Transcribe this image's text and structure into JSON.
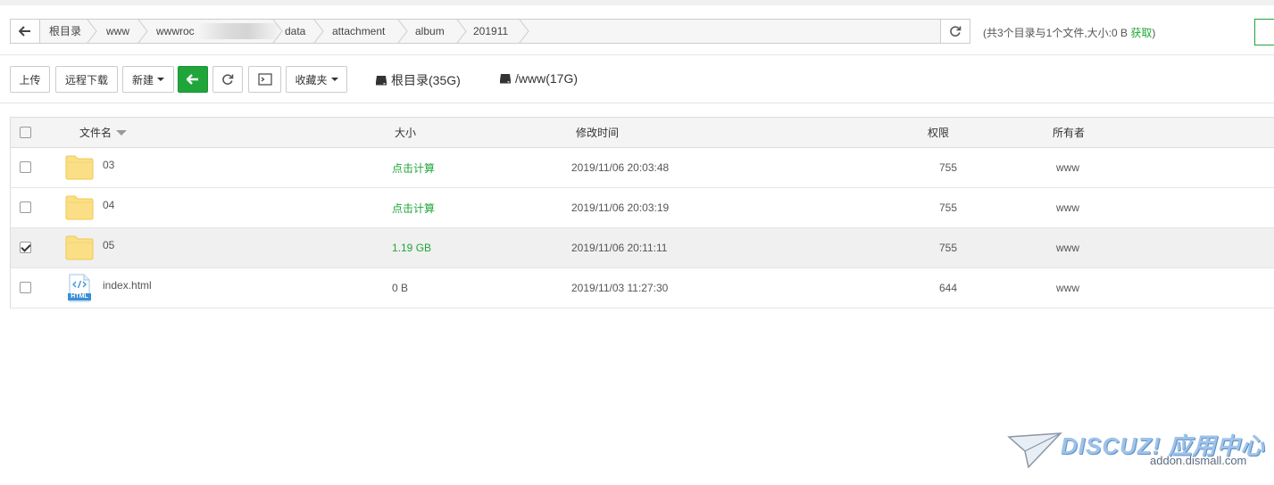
{
  "path": {
    "crumbs": [
      "根目录",
      "www",
      "wwwroc",
      "data",
      "attachment",
      "album",
      "201911"
    ]
  },
  "stats": {
    "summary": "(共3个目录与1个文件,大小:0 B ",
    "get_link": "获取",
    "close_paren": ")"
  },
  "toolbar": {
    "upload": "上传",
    "remote_download": "远程下载",
    "new": "新建",
    "favorites": "收藏夹",
    "disks": [
      {
        "label": "根目录(35G)"
      },
      {
        "label": "/www(17G)"
      }
    ]
  },
  "table": {
    "headers": {
      "name": "文件名",
      "size": "大小",
      "mtime": "修改时间",
      "perm": "权限",
      "owner": "所有者"
    },
    "rows": [
      {
        "name": "03",
        "type": "folder",
        "size": "点击计算",
        "size_is_link": true,
        "mtime": "2019/11/06 20:03:48",
        "perm": "755",
        "owner": "www",
        "checked": false
      },
      {
        "name": "04",
        "type": "folder",
        "size": "点击计算",
        "size_is_link": true,
        "mtime": "2019/11/06 20:03:19",
        "perm": "755",
        "owner": "www",
        "checked": false
      },
      {
        "name": "05",
        "type": "folder",
        "size": "1.19 GB",
        "size_is_link": true,
        "mtime": "2019/11/06 20:11:11",
        "perm": "755",
        "owner": "www",
        "checked": true
      },
      {
        "name": "index.html",
        "type": "html",
        "size": "0 B",
        "size_is_link": false,
        "mtime": "2019/11/03 11:27:30",
        "perm": "644",
        "owner": "www",
        "checked": false
      }
    ],
    "html_badge": "HTML"
  },
  "watermark": {
    "title": "DISCUZ! 应用中心",
    "url": "addon.dismall.com"
  },
  "colors": {
    "accent": "#20a53a",
    "folder": "#fbdf86"
  }
}
